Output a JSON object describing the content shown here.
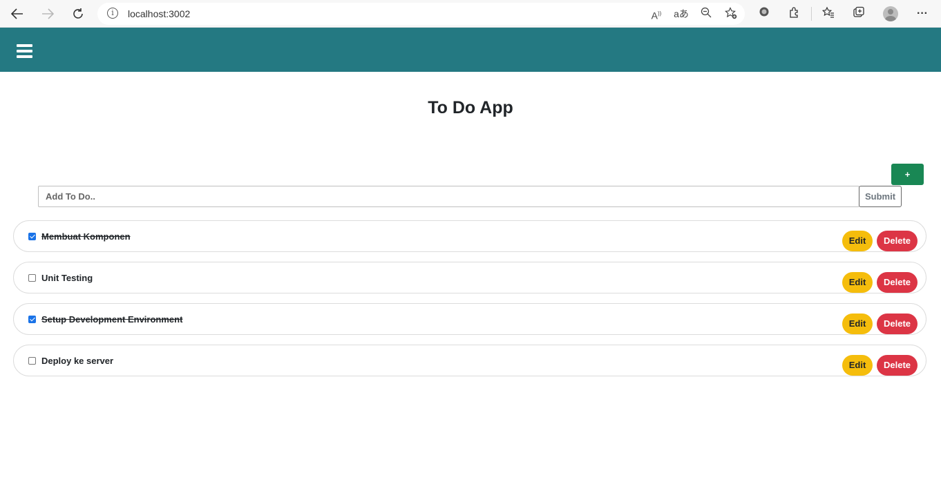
{
  "browser": {
    "url": "localhost:3002",
    "icons": [
      "back-icon",
      "forward-icon",
      "refresh-icon",
      "info-icon",
      "read-aloud-icon",
      "translate-icon",
      "zoom-out-icon",
      "add-favorite-icon",
      "extension-circle-icon",
      "extensions-icon",
      "favorites-icon",
      "collections-icon",
      "profile-icon",
      "more-icon"
    ]
  },
  "header": {
    "menu_icon": "hamburger-icon",
    "background": "#247982"
  },
  "main": {
    "title": "To Do App",
    "add_button_label": "+",
    "input": {
      "placeholder": "Add To Do..",
      "value": ""
    },
    "submit_label": "Submit"
  },
  "todos": [
    {
      "text": "Membuat Komponen",
      "completed": true,
      "edit_label": "Edit",
      "delete_label": "Delete"
    },
    {
      "text": "Unit Testing",
      "completed": false,
      "edit_label": "Edit",
      "delete_label": "Delete"
    },
    {
      "text": "Setup Development Environment",
      "completed": true,
      "edit_label": "Edit",
      "delete_label": "Delete"
    },
    {
      "text": "Deploy ke server",
      "completed": false,
      "edit_label": "Edit",
      "delete_label": "Delete"
    }
  ],
  "colors": {
    "success": "#198754",
    "warning": "#f5bd0c",
    "danger": "#dc3545",
    "checkbox": "#1a73e8"
  }
}
